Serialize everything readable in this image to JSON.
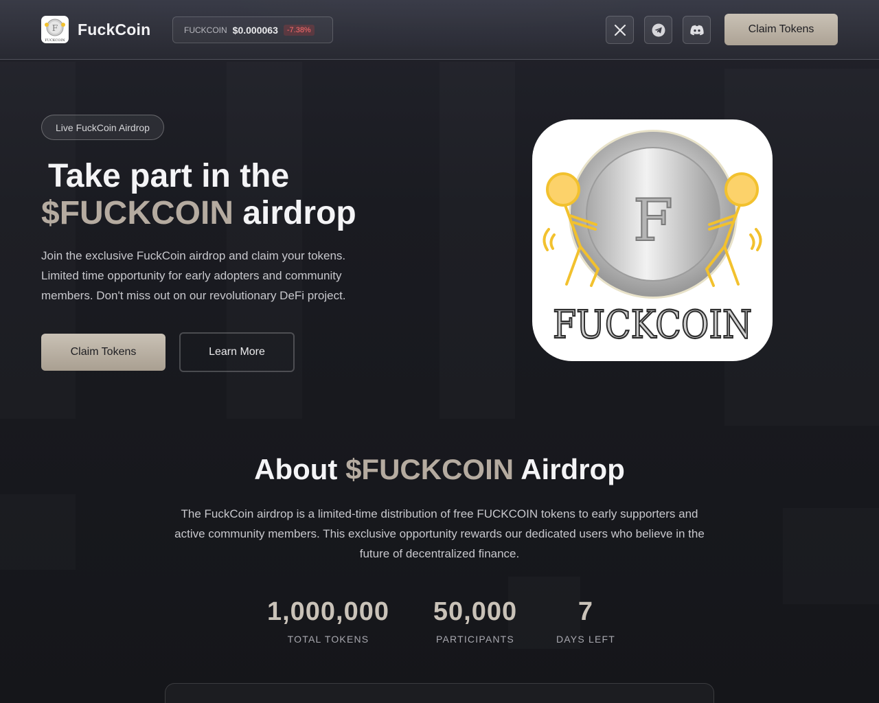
{
  "nav": {
    "brand": "FuckCoin",
    "logo_text": "FUCKCOIN",
    "ticker": {
      "symbol": "FUCKCOIN",
      "price": "$0.000063",
      "change": "-7.38%"
    },
    "socials": [
      {
        "name": "x",
        "icon": "x-icon"
      },
      {
        "name": "telegram",
        "icon": "telegram-icon"
      },
      {
        "name": "discord",
        "icon": "discord-icon"
      }
    ],
    "claim_label": "Claim Tokens"
  },
  "hero": {
    "badge": "Live FuckCoin Airdrop",
    "title_line1": "Take part in the",
    "title_accent": "$FUCKCOIN",
    "title_rest": " airdrop",
    "description": "Join the exclusive FuckCoin airdrop and claim your tokens. Limited time opportunity for early adopters and community members. Don't miss out on our revolutionary DeFi project.",
    "claim_label": "Claim Tokens",
    "learn_label": "Learn More",
    "image_letter": "F",
    "image_caption": "FUCKCOIN"
  },
  "about": {
    "title_prefix": "About ",
    "title_accent": "$FUCKCOIN",
    "title_suffix": " Airdrop",
    "description": "The FuckCoin airdrop is a limited-time distribution of free FUCKCOIN tokens to early supporters and active community members. This exclusive opportunity rewards our dedicated users who believe in the future of decentralized finance.",
    "stats": [
      {
        "value": "1,000,000",
        "label": "TOTAL TOKENS"
      },
      {
        "value": "50,000",
        "label": "PARTICIPANTS"
      },
      {
        "value": "7",
        "label": "DAYS LEFT"
      }
    ]
  },
  "colors": {
    "background": "#16171c",
    "accent": "#b5aba0",
    "button": "#c4bcb0",
    "negative": "#ff6b6b",
    "coin_figures": "#f2c12e"
  }
}
